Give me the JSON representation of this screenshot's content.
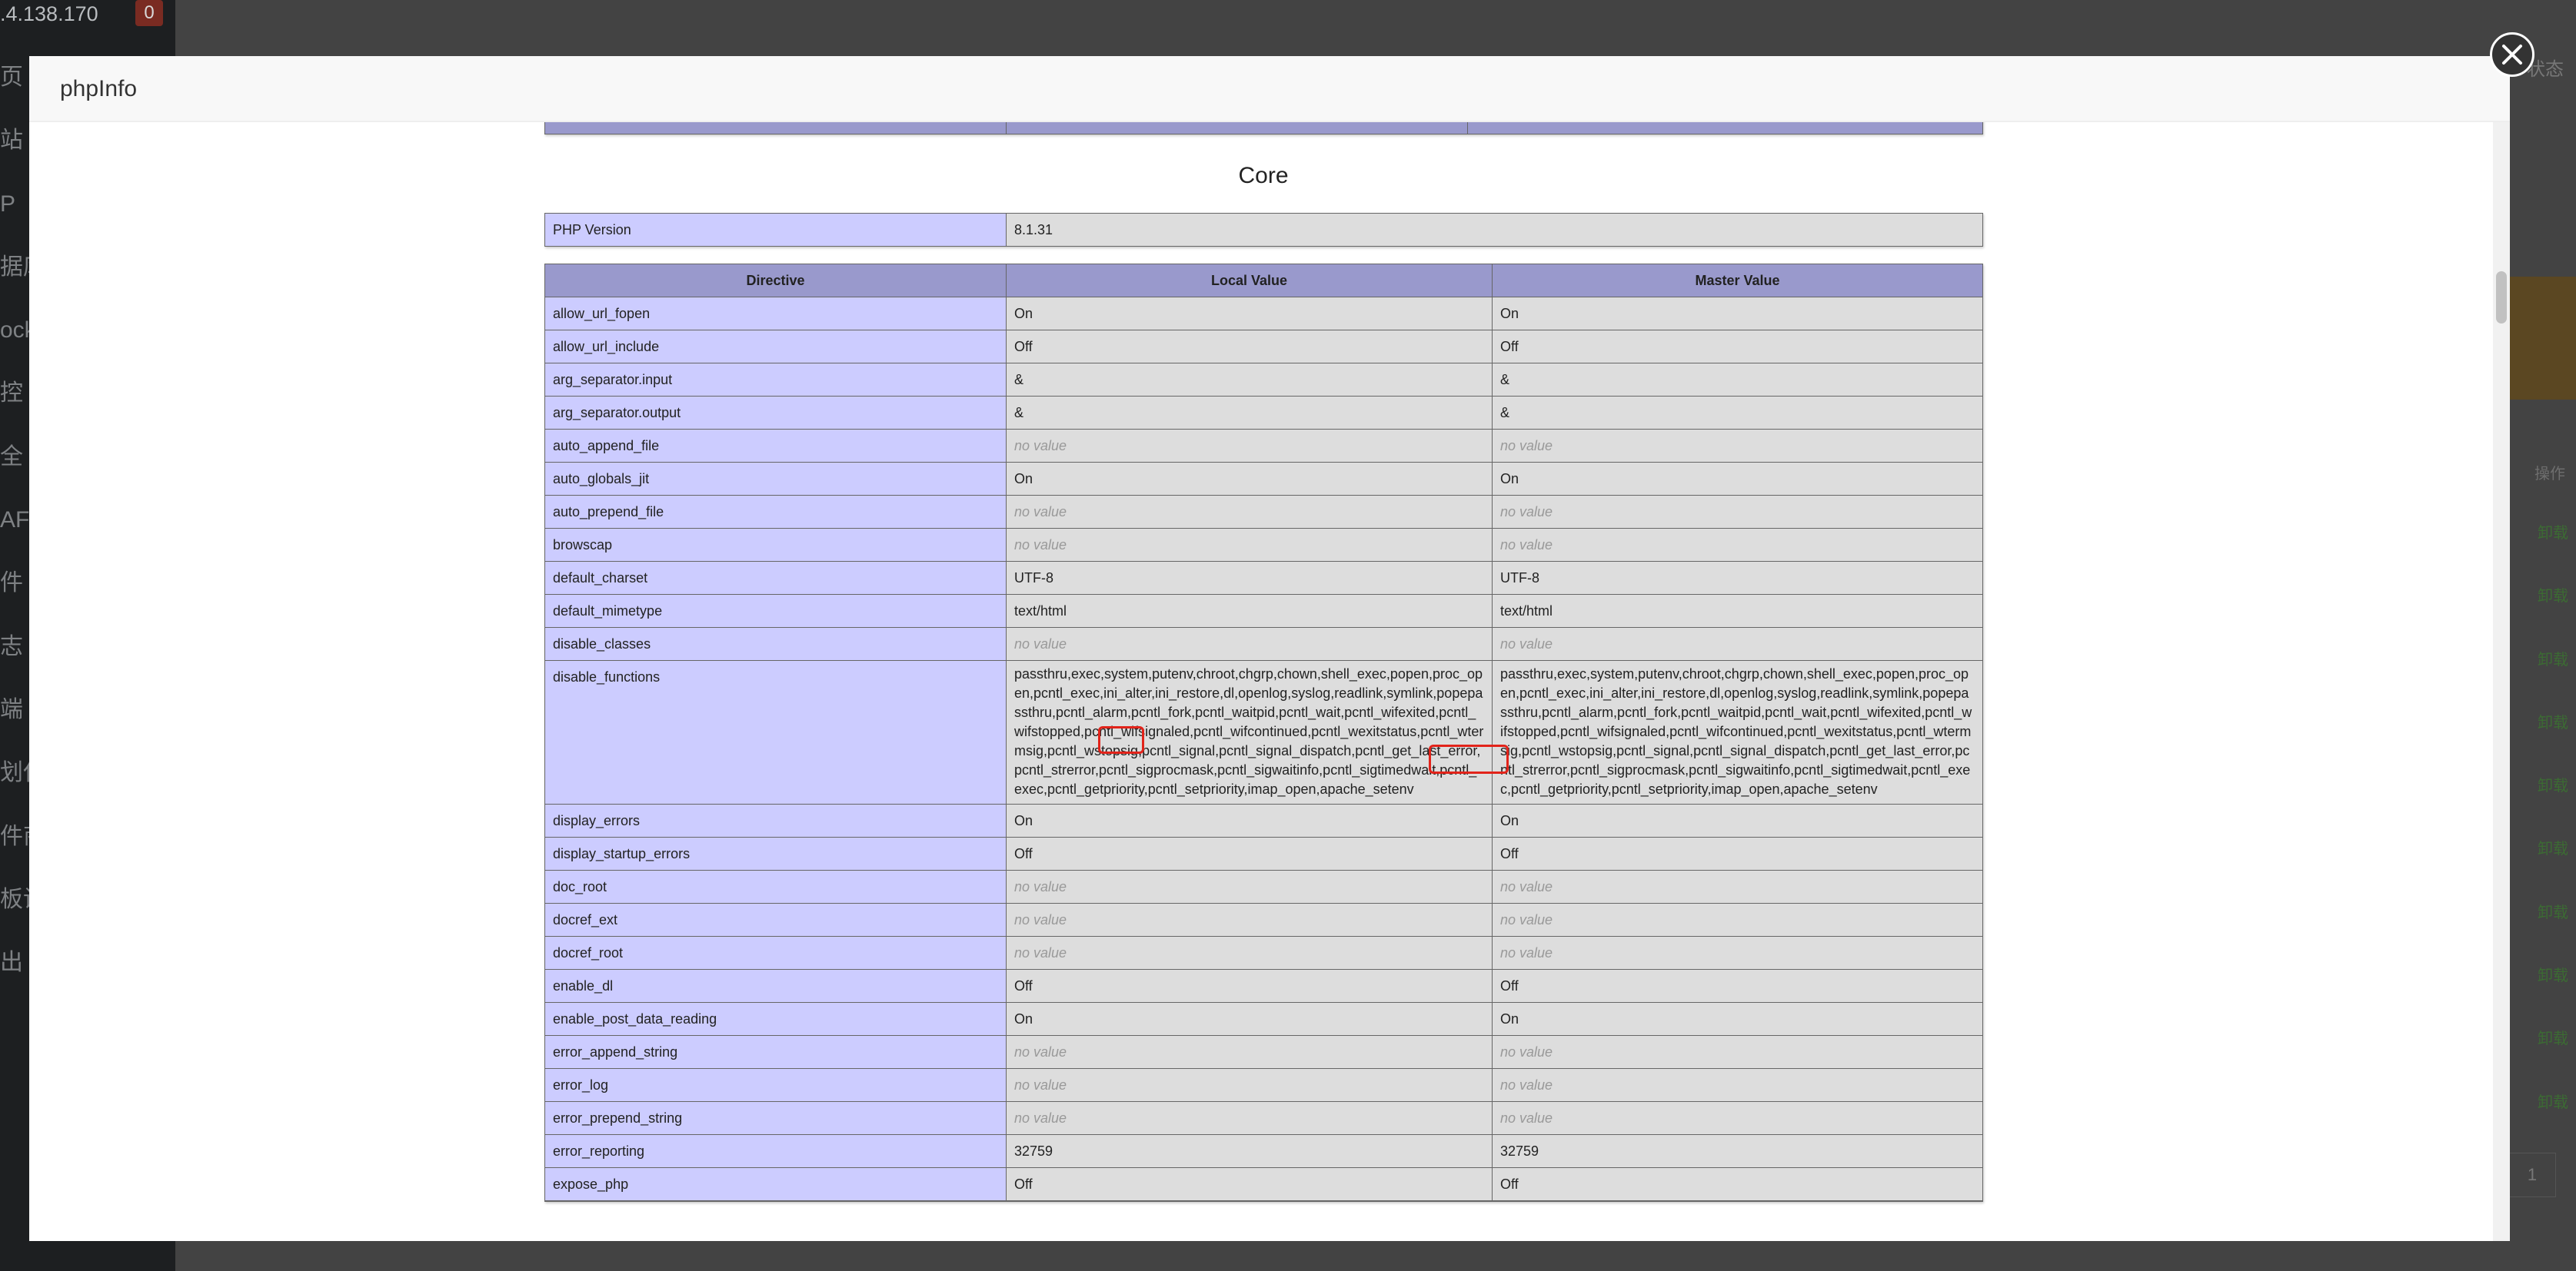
{
  "background": {
    "ip_fragment": ".4.138.170",
    "badge_count": "0",
    "nav_items": [
      "页",
      "站",
      "P",
      "据库",
      "ock",
      "控",
      "全",
      "AF",
      "件",
      "志",
      "端",
      "划任",
      "件商",
      "板设",
      "出"
    ],
    "status_fragment": "状态",
    "column_header_fragment": "操作",
    "action_links": [
      "卸载",
      "卸载",
      "卸载",
      "卸载",
      "卸载",
      "卸载",
      "卸载",
      "卸载",
      "卸载",
      "卸载"
    ],
    "page_number": "1"
  },
  "modal": {
    "title": "phpInfo"
  },
  "phpinfo": {
    "headers": {
      "directive": "Directive",
      "local": "Local Value",
      "master": "Master Value"
    },
    "section_title": "Core",
    "php_version": {
      "label": "PHP Version",
      "value": "8.1.31"
    },
    "rows": [
      {
        "directive": "allow_url_fopen",
        "local": "On",
        "master": "On",
        "no_value": false
      },
      {
        "directive": "allow_url_include",
        "local": "Off",
        "master": "Off",
        "no_value": false
      },
      {
        "directive": "arg_separator.input",
        "local": "&",
        "master": "&",
        "no_value": false
      },
      {
        "directive": "arg_separator.output",
        "local": "&",
        "master": "&",
        "no_value": false
      },
      {
        "directive": "auto_append_file",
        "local": "no value",
        "master": "no value",
        "no_value": true
      },
      {
        "directive": "auto_globals_jit",
        "local": "On",
        "master": "On",
        "no_value": false
      },
      {
        "directive": "auto_prepend_file",
        "local": "no value",
        "master": "no value",
        "no_value": true
      },
      {
        "directive": "browscap",
        "local": "no value",
        "master": "no value",
        "no_value": true
      },
      {
        "directive": "default_charset",
        "local": "UTF-8",
        "master": "UTF-8",
        "no_value": false
      },
      {
        "directive": "default_mimetype",
        "local": "text/html",
        "master": "text/html",
        "no_value": false
      },
      {
        "directive": "disable_classes",
        "local": "no value",
        "master": "no value",
        "no_value": true
      },
      {
        "directive": "disable_functions",
        "local": "passthru,exec,system,putenv,chroot,chgrp,chown,shell_exec,popen,proc_open,pcntl_exec,ini_alter,ini_restore,dl,openlog,syslog,readlink,symlink,popepassthru,pcntl_alarm,pcntl_fork,pcntl_waitpid,pcntl_wait,pcntl_wifexited,pcntl_wifstopped,pcntl_wifsignaled,pcntl_wifcontinued,pcntl_wexitstatus,pcntl_wtermsig,pcntl_wstopsig,pcntl_signal,pcntl_signal_dispatch,pcntl_get_last_error,pcntl_strerror,pcntl_sigprocmask,pcntl_sigwaitinfo,pcntl_sigtimedwait,pcntl_exec,pcntl_getpriority,pcntl_setpriority,imap_open,apache_setenv",
        "master": "passthru,exec,system,putenv,chroot,chgrp,chown,shell_exec,popen,proc_open,pcntl_exec,ini_alter,ini_restore,dl,openlog,syslog,readlink,symlink,popepassthru,pcntl_alarm,pcntl_fork,pcntl_waitpid,pcntl_wait,pcntl_wifexited,pcntl_wifstopped,pcntl_wifsignaled,pcntl_wifcontinued,pcntl_wexitstatus,pcntl_wtermsig,pcntl_wstopsig,pcntl_signal,pcntl_signal_dispatch,pcntl_get_last_error,pcntl_strerror,pcntl_sigprocmask,pcntl_sigwaitinfo,pcntl_sigtimedwait,pcntl_exec,pcntl_getpriority,pcntl_setpriority,imap_open,apache_setenv",
        "no_value": false,
        "long": true
      },
      {
        "directive": "display_errors",
        "local": "On",
        "master": "On",
        "no_value": false
      },
      {
        "directive": "display_startup_errors",
        "local": "Off",
        "master": "Off",
        "no_value": false
      },
      {
        "directive": "doc_root",
        "local": "no value",
        "master": "no value",
        "no_value": true
      },
      {
        "directive": "docref_ext",
        "local": "no value",
        "master": "no value",
        "no_value": true
      },
      {
        "directive": "docref_root",
        "local": "no value",
        "master": "no value",
        "no_value": true
      },
      {
        "directive": "enable_dl",
        "local": "Off",
        "master": "Off",
        "no_value": false
      },
      {
        "directive": "enable_post_data_reading",
        "local": "On",
        "master": "On",
        "no_value": false
      },
      {
        "directive": "error_append_string",
        "local": "no value",
        "master": "no value",
        "no_value": true
      },
      {
        "directive": "error_log",
        "local": "no value",
        "master": "no value",
        "no_value": true
      },
      {
        "directive": "error_prepend_string",
        "local": "no value",
        "master": "no value",
        "no_value": true
      },
      {
        "directive": "error_reporting",
        "local": "32759",
        "master": "32759",
        "no_value": false
      },
      {
        "directive": "expose_php",
        "local": "Off",
        "master": "Off",
        "no_value": false
      },
      {
        "directive": "",
        "local": "",
        "master": "",
        "no_value": false
      }
    ]
  },
  "colors": {
    "header_bg": "#9999cc",
    "directive_bg": "#ccccff",
    "value_bg": "#dddddd",
    "highlight": "#e2231a"
  }
}
